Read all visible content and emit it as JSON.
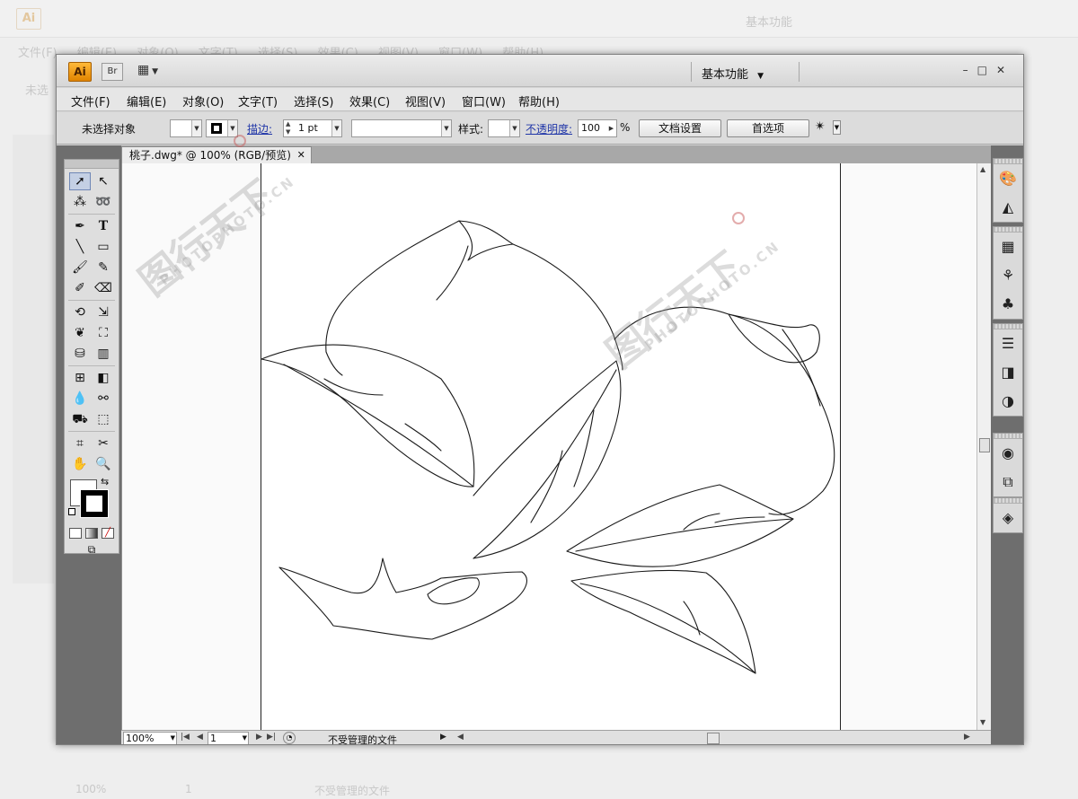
{
  "app": {
    "logo": "Ai",
    "bridge_button": "Br",
    "workspace": "基本功能",
    "window_controls": [
      "–",
      "□",
      "✕"
    ]
  },
  "menu": [
    "文件(F)",
    "编辑(E)",
    "对象(O)",
    "文字(T)",
    "选择(S)",
    "效果(C)",
    "视图(V)",
    "窗口(W)",
    "帮助(H)"
  ],
  "control_panel": {
    "selection_status": "未选择对象",
    "stroke_label": "描边:",
    "stroke_weight": "1 pt",
    "style_label": "样式:",
    "opacity_label": "不透明度:",
    "opacity_value": "100",
    "opacity_unit": "%",
    "document_setup_button": "文档设置",
    "preferences_button": "首选项"
  },
  "document": {
    "tab_title": "桃子.dwg* @ 100% (RGB/预览)",
    "tab_close": "✕"
  },
  "status_bar": {
    "zoom": "100%",
    "artboard_number": "1",
    "status_text": "不受管理的文件"
  },
  "background_ghost": {
    "logo": "Ai",
    "workspace": "基本功能",
    "menu": [
      "文件(F)",
      "编辑(E)",
      "对象(O)",
      "文字(T)",
      "选择(S)",
      "效果(C)",
      "视图(V)",
      "窗口(W)",
      "帮助(H)"
    ],
    "selection_status": "未选",
    "zoom": "100%",
    "artboard_number": "1",
    "status_text": "不受管理的文件"
  },
  "watermark": {
    "logo_text": "图行天下",
    "site_text": "PHOTOPHOTO.CN"
  },
  "tools": [
    "selection",
    "direct-selection",
    "magic-wand",
    "lasso",
    "pen",
    "type",
    "line-segment",
    "rectangle",
    "paintbrush",
    "pencil",
    "blob-brush",
    "eraser",
    "rotate",
    "scale",
    "warp",
    "free-transform",
    "symbol-sprayer",
    "column-graph",
    "mesh",
    "gradient",
    "eyedropper",
    "blend",
    "live-paint-bucket",
    "live-paint-selection",
    "artboard",
    "slice",
    "hand",
    "zoom"
  ],
  "panel_icons": [
    "color",
    "color-guide",
    "swatches",
    "brushes",
    "symbols",
    "stroke",
    "gradient",
    "transparency",
    "appearance",
    "graphic-styles",
    "layers"
  ]
}
